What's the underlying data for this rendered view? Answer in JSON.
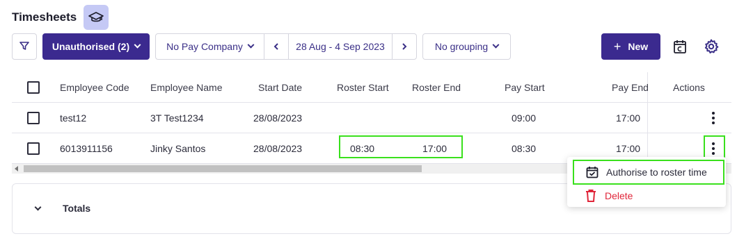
{
  "page": {
    "title": "Timesheets",
    "icons": {
      "title_badge": "graduation-cap-icon",
      "filter": "filter-icon",
      "calendar": "calendar-icon",
      "settings": "gear-icon"
    }
  },
  "toolbar": {
    "status_filter": "Unauthorised (2)",
    "pay_company": "No Pay Company",
    "date_range": "28 Aug - 4 Sep 2023",
    "grouping": "No grouping",
    "new_label": "New",
    "new_prefix": "+"
  },
  "table": {
    "columns": [
      "Employee Code",
      "Employee Name",
      "Start Date",
      "Roster Start",
      "Roster End",
      "Pay Start",
      "Pay End",
      "Actions"
    ],
    "rows": [
      {
        "employee_code": "test12",
        "employee_name": "3T Test1234",
        "start_date": "28/08/2023",
        "roster_start": "",
        "roster_end": "",
        "pay_start": "09:00",
        "pay_end": "17:00"
      },
      {
        "employee_code": "6013911156",
        "employee_name": "Jinky Santos",
        "start_date": "28/08/2023",
        "roster_start": "08:30",
        "roster_end": "17:00",
        "pay_start": "08:30",
        "pay_end": "17:00"
      }
    ]
  },
  "context_menu": {
    "items": [
      {
        "label": "Authorise to roster time",
        "icon": "calendar-check-icon"
      },
      {
        "label": "Delete",
        "icon": "trash-icon"
      }
    ]
  },
  "totals": {
    "label": "Totals"
  },
  "colors": {
    "primary": "#3b2a8f",
    "highlight": "#39e01c",
    "danger": "#e0263a",
    "badge": "#c5c9f5"
  }
}
